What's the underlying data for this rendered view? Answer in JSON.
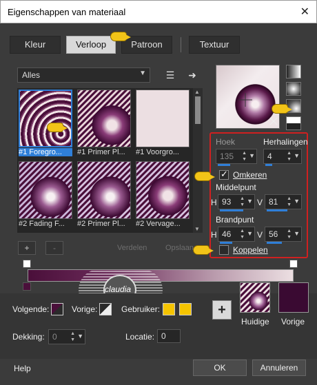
{
  "window": {
    "title": "Eigenschappen van materiaal",
    "close_icon": "close-icon"
  },
  "tabs": [
    {
      "label": "Kleur",
      "active": false
    },
    {
      "label": "Verloop",
      "active": true
    },
    {
      "label": "Patroon",
      "active": false
    },
    {
      "label": "Textuur",
      "active": false
    }
  ],
  "category_select": {
    "value": "Alles"
  },
  "gradients": [
    {
      "caption": "#1 Foregro...",
      "selected": true
    },
    {
      "caption": "#1 Primer Pl...",
      "selected": false
    },
    {
      "caption": "#1 Voorgro...",
      "selected": false
    },
    {
      "caption": "#2 Fading F...",
      "selected": false
    },
    {
      "caption": "#2 Primer Pl...",
      "selected": false
    },
    {
      "caption": "#2 Vervage...",
      "selected": false
    }
  ],
  "settings": {
    "angle_label": "Hoek",
    "angle_value": "135",
    "repeats_label": "Herhalingen",
    "repeats_value": "4",
    "invert_label": "Omkeren",
    "invert_checked": true,
    "center_label": "Middelpunt",
    "center_h_label": "H",
    "center_h_value": "93",
    "center_v_label": "V",
    "center_v_value": "81",
    "focal_label": "Brandpunt",
    "focal_h_label": "H",
    "focal_h_value": "46",
    "focal_v_label": "V",
    "focal_v_value": "56",
    "link_label": "Koppelen",
    "link_checked": false
  },
  "stops": {
    "add_label": "+",
    "remove_label": "-",
    "ghost_left": "Verdelen",
    "ghost_right": "Opslaan"
  },
  "watermark": {
    "text": "claudia"
  },
  "colors": {
    "next_label": "Volgende:",
    "next_color": "#4a0f3a",
    "prev_label": "Vorige:",
    "user_label": "Gebruiker:",
    "user_color": "#f5c400",
    "opacity_label": "Dekking:",
    "opacity_value": "0",
    "location_label": "Locatie:",
    "location_value": "0",
    "current_label": "Huidige",
    "previous_label": "Vorige",
    "previous_color": "#3a0a32"
  },
  "footer": {
    "help": "Help",
    "ok": "OK",
    "cancel": "Annuleren"
  }
}
